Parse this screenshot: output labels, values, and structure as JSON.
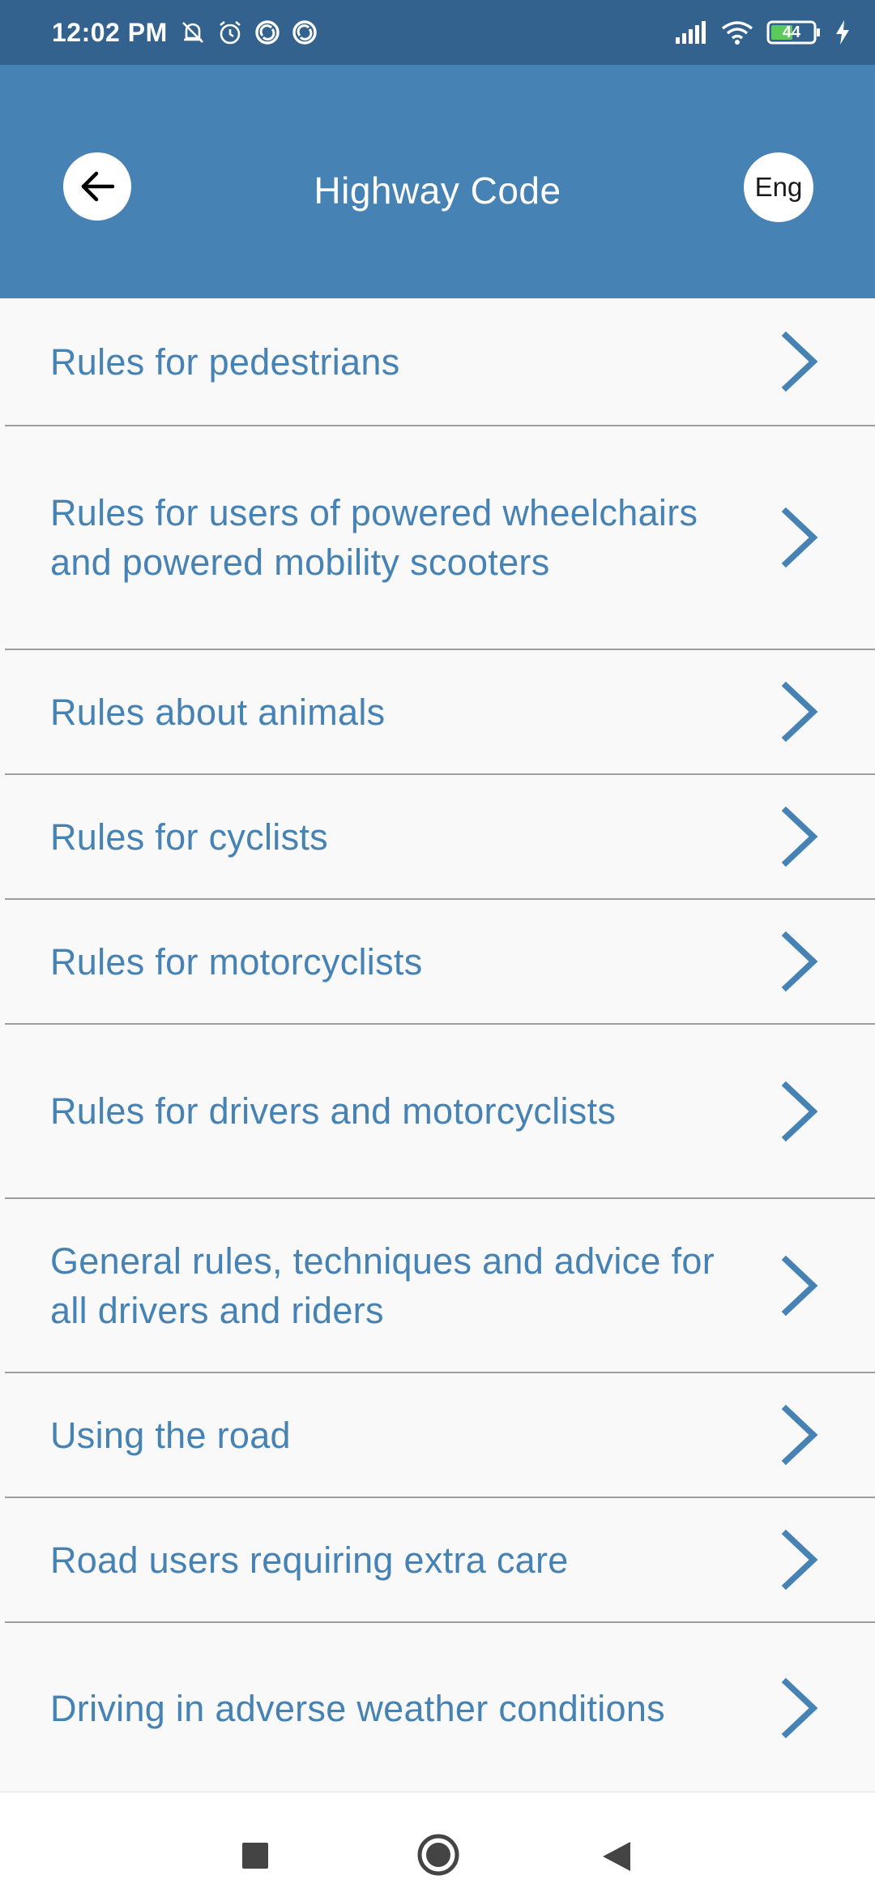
{
  "status_bar": {
    "time": "12:02 PM",
    "battery": "44",
    "icons_left": [
      "mute-bell-icon",
      "alarm-icon",
      "sync-icon",
      "sync-icon"
    ],
    "icons_right": [
      "signal-icon",
      "wifi-icon",
      "battery-icon",
      "charging-icon"
    ]
  },
  "app_bar": {
    "title": "Highway Code",
    "language": "Eng",
    "back_icon": "arrow-left-icon",
    "color": "#4682b4"
  },
  "list": {
    "items": [
      {
        "label": "Rules for pedestrians"
      },
      {
        "label": "Rules for users of powered wheelchairs and powered mobility scooters"
      },
      {
        "label": "Rules about animals"
      },
      {
        "label": "Rules for cyclists"
      },
      {
        "label": "Rules for motorcyclists"
      },
      {
        "label": "Rules for drivers and motorcyclists"
      },
      {
        "label": "General rules, techniques and advice for all drivers and riders"
      },
      {
        "label": "Using the road"
      },
      {
        "label": "Road users requiring extra care"
      },
      {
        "label": "Driving in adverse weather conditions"
      }
    ],
    "chevron_icon": "chevron-right-icon",
    "text_color": "#4682b4"
  },
  "nav_bar": {
    "buttons": [
      "recents-button",
      "home-button",
      "back-button"
    ]
  }
}
